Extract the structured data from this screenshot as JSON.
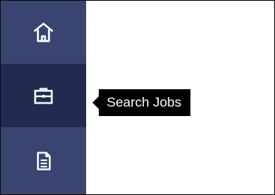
{
  "sidebar": {
    "items": [
      {
        "id": "home",
        "icon": "home-icon",
        "active": false
      },
      {
        "id": "search-jobs",
        "icon": "briefcase-icon",
        "active": true
      },
      {
        "id": "documents",
        "icon": "document-icon",
        "active": false
      }
    ]
  },
  "tooltip": {
    "text": "Search Jobs"
  },
  "colors": {
    "sidebar_bg": "#3b4370",
    "active_item_bg": "#222a4f",
    "icon": "#ffffff",
    "tooltip_bg": "#000000",
    "tooltip_text": "#ffffff",
    "content_bg": "#ffffff",
    "border": "#111111"
  }
}
